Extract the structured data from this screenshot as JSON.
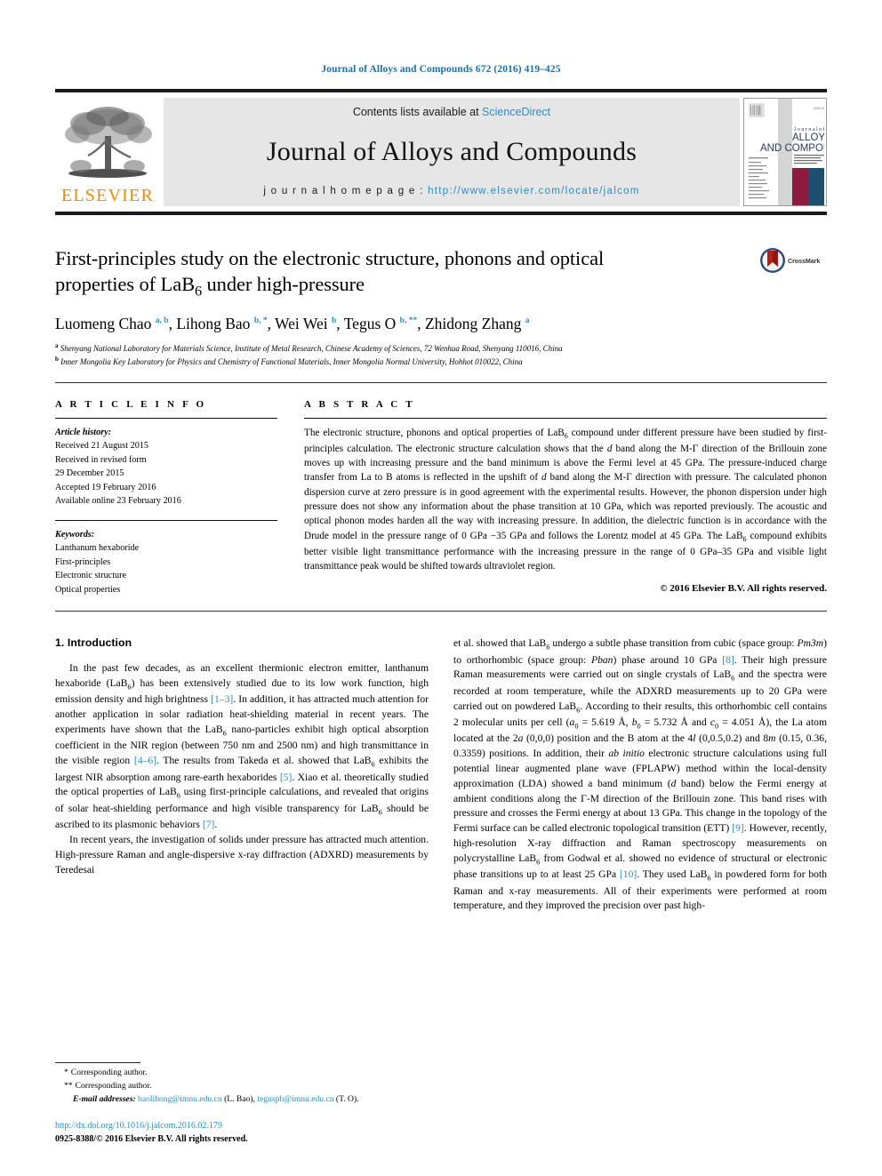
{
  "running_head": "Journal of Alloys and Compounds 672 (2016) 419–425",
  "masthead": {
    "publisher": "ELSEVIER",
    "contents_prefix": "Contents lists available at ",
    "contents_link": "ScienceDirect",
    "journal_title": "Journal of Alloys and Compounds",
    "homepage_prefix": "j o u r n a l   h o m e p a g e :  ",
    "homepage_url": "http://www.elsevier.com/locate/jalcom",
    "cover": {
      "line_journal_of": "Journal of",
      "line_alloys": "ALLOYS",
      "line_and_compounds": "AND COMPOUNDS"
    }
  },
  "title": {
    "line1": "First-principles study on the electronic structure, phonons and optical",
    "line2_pre": "properties of LaB",
    "line2_sub": "6",
    "line2_post": " under high-pressure",
    "crossmark_label": "CrossMark"
  },
  "authors": {
    "list": [
      {
        "name": "Luomeng Chao",
        "marks": "a, b"
      },
      {
        "name": "Lihong Bao",
        "marks": "b, *"
      },
      {
        "name": "Wei Wei",
        "marks": "b"
      },
      {
        "name": "Tegus O",
        "marks": "b, **"
      },
      {
        "name": "Zhidong Zhang",
        "marks": "a"
      }
    ],
    "affiliations": [
      {
        "mark": "a",
        "text": "Shenyang National Laboratory for Materials Science, Institute of Metal Research, Chinese Academy of Sciences, 72 Wenhua Road, Shenyang 110016, China"
      },
      {
        "mark": "b",
        "text": "Inner Mongolia Key Laboratory for Physics and Chemistry of Functional Materials, Inner Mongolia Normal University, Hohhot 010022, China"
      }
    ]
  },
  "article_info": {
    "heading": "A R T I C L E   I N F O",
    "history_label": "Article history:",
    "history": [
      "Received 21 August 2015",
      "Received in revised form",
      "29 December 2015",
      "Accepted 19 February 2016",
      "Available online 23 February 2016"
    ],
    "keywords_label": "Keywords:",
    "keywords": [
      "Lanthanum hexaboride",
      "First-principles",
      "Electronic structure",
      "Optical properties"
    ]
  },
  "abstract": {
    "heading": "A B S T R A C T",
    "text": "The electronic structure, phonons and optical properties of LaB6 compound under different pressure have been studied by first-principles calculation. The electronic structure calculation shows that the d band along the M-Γ direction of the Brillouin zone moves up with increasing pressure and the band minimum is above the Fermi level at 45 GPa. The pressure-induced charge transfer from La to B atoms is reflected in the upshift of d band along the M-Γ direction with pressure. The calculated phonon dispersion curve at zero pressure is in good agreement with the experimental results. However, the phonon dispersion under high pressure does not show any information about the phase transition at 10 GPa, which was reported previously. The acoustic and optical phonon modes harden all the way with increasing pressure. In addition, the dielectric function is in accordance with the Drude model in the pressure range of 0 GPa −35 GPa and follows the Lorentz model at 45 GPa. The LaB6 compound exhibits better visible light transmittance performance with the increasing pressure in the range of 0 GPa–35 GPa and visible light transmittance peak would be shifted towards ultraviolet region.",
    "copyright": "© 2016 Elsevier B.V. All rights reserved."
  },
  "body": {
    "section_number_title": "1.  Introduction",
    "left_paragraph_1": "In the past few decades, as an excellent thermionic electron emitter, lanthanum hexaboride (LaB6) has been extensively studied due to its low work function, high emission density and high brightness [1–3]. In addition, it has attracted much attention for another application in solar radiation heat-shielding material in recent years. The experiments have shown that the LaB6 nano-particles exhibit high optical absorption coefficient in the NIR region (between 750 nm and 2500 nm) and high transmittance in the visible region [4–6]. The results from Takeda et al. showed that LaB6 exhibits the largest NIR absorption among rare-earth hexaborides [5]. Xiao et al. theoretically studied the optical properties of LaB6 using first-principle calculations, and revealed that origins of solar heat-shielding performance and high visible transparency for LaB6 should be ascribed to its plasmonic behaviors [7].",
    "left_paragraph_2": "In recent years, the investigation of solids under pressure has attracted much attention. High-pressure Raman and angle-dispersive x-ray diffraction (ADXRD) measurements by Teredesai",
    "right_paragraph_1": "et al. showed that LaB6 undergo a subtle phase transition from cubic (space group: Pm3m) to orthorhombic (space group: Pban) phase around 10 GPa [8]. Their high pressure Raman measurements were carried out on single crystals of LaB6 and the spectra were recorded at room temperature, while the ADXRD measurements up to 20 GPa were carried out on powdered LaB6. According to their results, this orthorhombic cell contains 2 molecular units per cell (a0 = 5.619 Å, b0 = 5.732 Å and c0 = 4.051 Å), the La atom located at the 2a (0,0,0) position and the B atom at the 4l (0,0.5,0.2) and 8m (0.15, 0.36, 0.3359) positions. In addition, their ab initio electronic structure calculations using full potential linear augmented plane wave (FPLAPW) method within the local-density approximation (LDA) showed a band minimum (d band) below the Fermi energy at ambient conditions along the Γ-M direction of the Brillouin zone. This band rises with pressure and crosses the Fermi energy at about 13 GPa. This change in the topology of the Fermi surface can be called electronic topological transition (ETT) [9]. However, recently, high-resolution X-ray diffraction and Raman spectroscopy measurements on polycrystalline LaB6 from Godwal et al. showed no evidence of structural or electronic phase transitions up to at least 25 GPa [10]. They used LaB6 in powdered form for both Raman and x-ray measurements. All of their experiments were performed at room temperature, and they improved the precision over past high-"
  },
  "footnotes": {
    "corresponding_1_mark": "*",
    "corresponding_1": "Corresponding author.",
    "corresponding_2_mark": "**",
    "corresponding_2": "Corresponding author.",
    "emails_label": "E-mail addresses:",
    "email_1": "baolihong@imnu.edu.cn",
    "email_1_owner": "(L. Bao),",
    "email_2": "tegusph@imnu.edu.cn",
    "email_2_owner": "(T. O).",
    "doi_url": "http://dx.doi.org/10.1016/j.jalcom.2016.02.179",
    "issn_line": "0925-8388/© 2016 Elsevier B.V. All rights reserved."
  },
  "colors": {
    "link": "#2b8cbe",
    "elsevier_orange": "#ED8B00",
    "rule": "#1a1a1a"
  }
}
